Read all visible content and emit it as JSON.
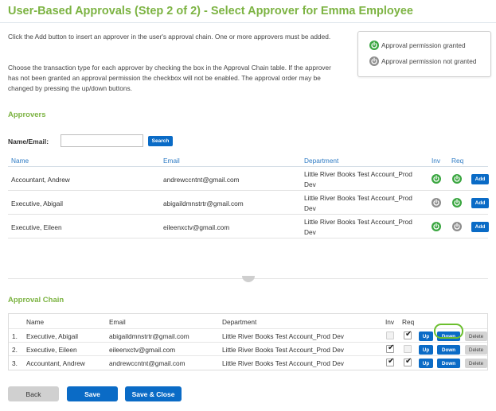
{
  "header": {
    "title": "User-Based Approvals (Step 2 of 2) - Select Approver for Emma Employee"
  },
  "intro": {
    "p1": "Click the Add button to insert an approver in the user's approval chain. One or more approvers must be added.",
    "p2": "Choose the transaction type for each approver by checking the box in the Approval Chain table. If the approver has not been granted an approval permission the checkbox will not be enabled. The approval order may be changed by pressing the up/down buttons."
  },
  "legend": {
    "granted": "Approval permission granted",
    "not_granted": "Approval permission not granted"
  },
  "approvers": {
    "heading": "Approvers",
    "search": {
      "label": "Name/Email:",
      "value": "",
      "button": "Search"
    },
    "columns": {
      "name": "Name",
      "email": "Email",
      "department": "Department",
      "inv": "Inv",
      "req": "Req"
    },
    "add_label": "Add",
    "rows": [
      {
        "name": "Accountant, Andrew",
        "email": "andrewccntnt@gmail.com",
        "department": "Little River Books Test Account_Prod Dev",
        "inv": true,
        "req": true
      },
      {
        "name": "Executive, Abigail",
        "email": "abigaildmnstrtr@gmail.com",
        "department": "Little River Books Test Account_Prod Dev",
        "inv": false,
        "req": true
      },
      {
        "name": "Executive, Eileen",
        "email": "eileenxctv@gmail.com",
        "department": "Little River Books Test Account_Prod Dev",
        "inv": true,
        "req": false
      }
    ]
  },
  "chain": {
    "heading": "Approval Chain",
    "columns": {
      "name": "Name",
      "email": "Email",
      "department": "Department",
      "inv": "Inv",
      "req": "Req"
    },
    "buttons": {
      "up": "Up",
      "down": "Down",
      "delete": "Delete"
    },
    "rows": [
      {
        "num": "1.",
        "name": "Executive, Abigail",
        "email": "abigaildmnstrtr@gmail.com",
        "department": "Little River Books Test Account_Prod Dev",
        "inv_checked": false,
        "inv_enabled": false,
        "req_checked": true,
        "req_enabled": true
      },
      {
        "num": "2.",
        "name": "Executive, Eileen",
        "email": "eileenxctv@gmail.com",
        "department": "Little River Books Test Account_Prod Dev",
        "inv_checked": true,
        "inv_enabled": true,
        "req_checked": false,
        "req_enabled": false
      },
      {
        "num": "3.",
        "name": "Accountant, Andrew",
        "email": "andrewccntnt@gmail.com",
        "department": "Little River Books Test Account_Prod Dev",
        "inv_checked": true,
        "inv_enabled": true,
        "req_checked": true,
        "req_enabled": true
      }
    ]
  },
  "footer": {
    "back": "Back",
    "save": "Save",
    "save_close": "Save & Close"
  },
  "colors": {
    "accent_green": "#7cb342",
    "button_blue": "#0a6bc6",
    "granted": "#3aa640",
    "not_granted": "#8d8d8d"
  }
}
